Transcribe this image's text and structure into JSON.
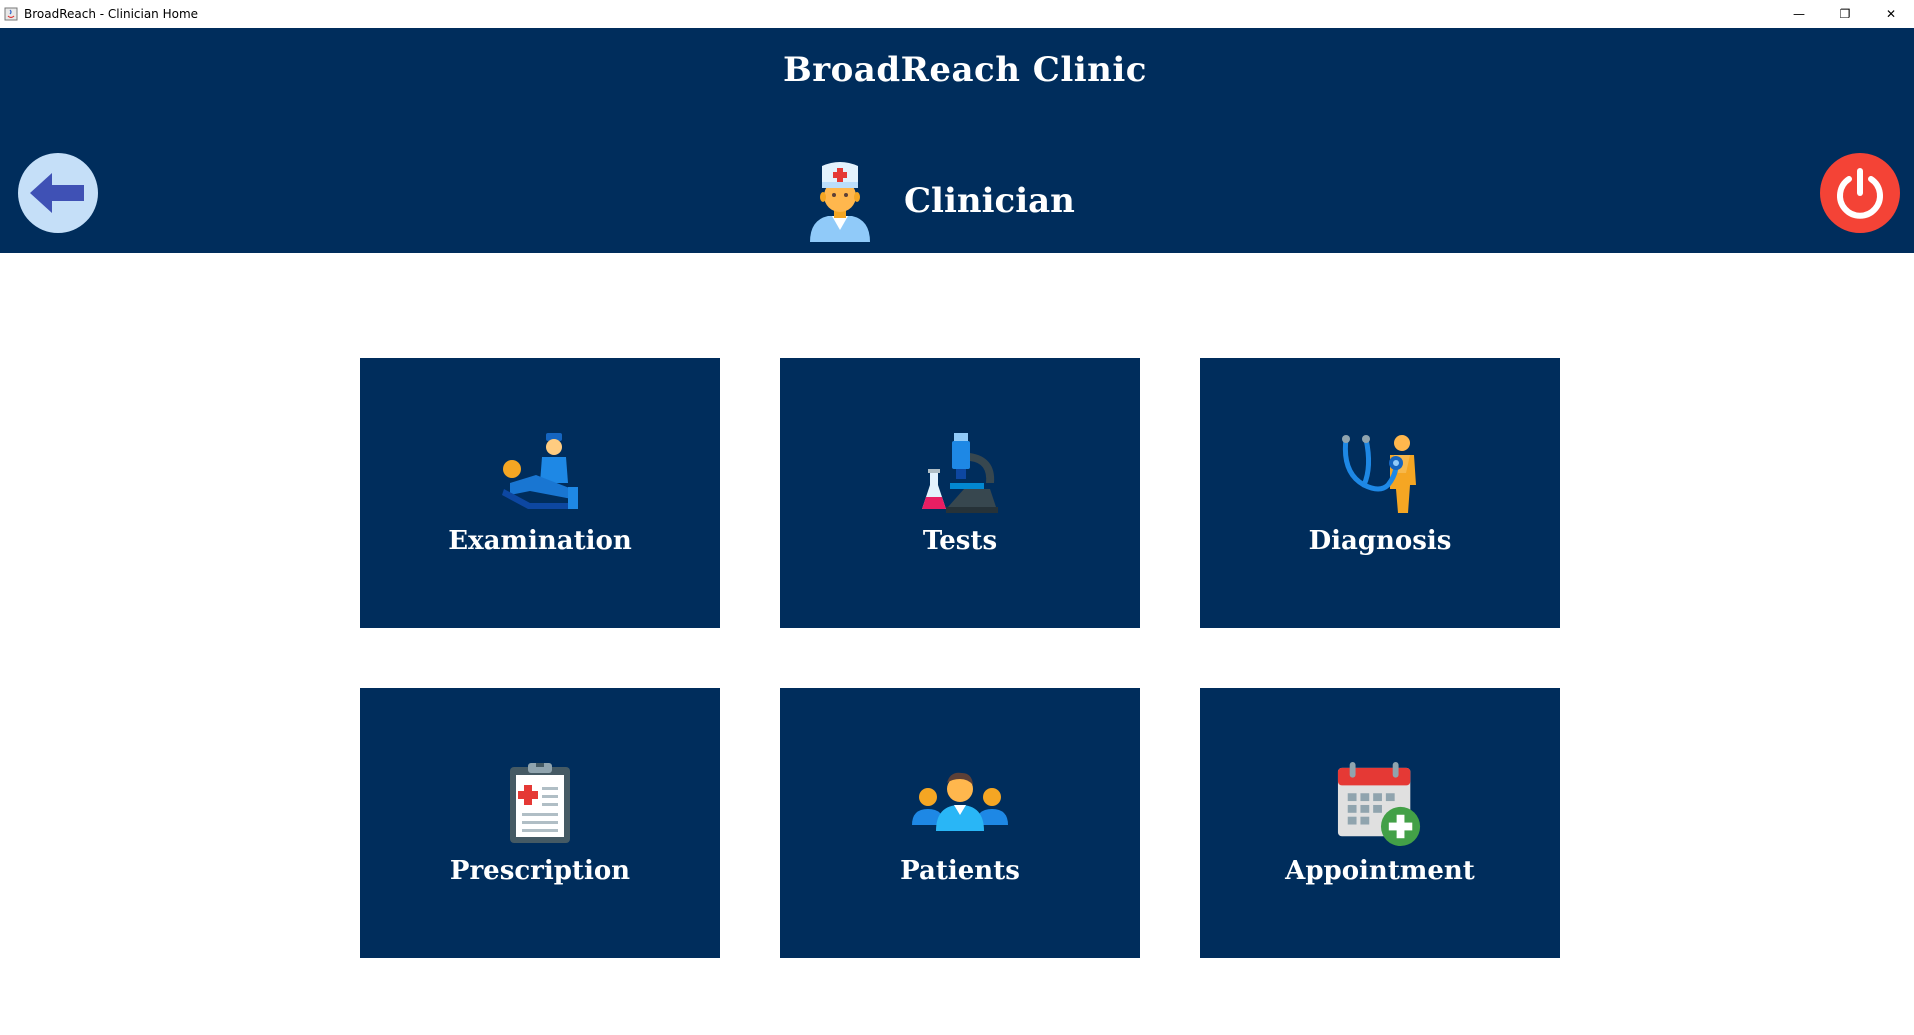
{
  "window": {
    "title": "BroadReach - Clinician Home",
    "minimize_label": "—",
    "restore_label": "❐",
    "close_label": "✕"
  },
  "header": {
    "clinic_name": "BroadReach Clinic",
    "role": "Clinician",
    "role_icon": "doctor-avatar-icon",
    "back_icon": "back-arrow-icon",
    "power_icon": "power-icon"
  },
  "tiles": [
    {
      "label": "Examination",
      "icon": "examination-icon"
    },
    {
      "label": "Tests",
      "icon": "microscope-icon"
    },
    {
      "label": "Diagnosis",
      "icon": "stethoscope-icon"
    },
    {
      "label": "Prescription",
      "icon": "clipboard-icon"
    },
    {
      "label": "Patients",
      "icon": "patients-group-icon"
    },
    {
      "label": "Appointment",
      "icon": "calendar-add-icon"
    }
  ],
  "colors": {
    "primary": "#002d5c",
    "back_button": "#c5dff8",
    "power_button": "#f44336",
    "text": "#ffffff"
  }
}
